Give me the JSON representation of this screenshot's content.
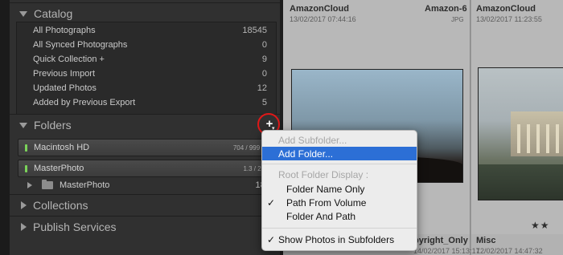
{
  "catalog": {
    "title": "Catalog",
    "items": [
      {
        "label": "All Photographs",
        "count": "18545"
      },
      {
        "label": "All Synced Photographs",
        "count": "0"
      },
      {
        "label": "Quick Collection  +",
        "count": "9"
      },
      {
        "label": "Previous Import",
        "count": "0"
      },
      {
        "label": "Updated Photos",
        "count": "12"
      },
      {
        "label": "Added by Previous Export",
        "count": "5"
      }
    ]
  },
  "folders": {
    "title": "Folders",
    "volumes": [
      {
        "name": "Macintosh HD",
        "size": "704 / 999 GB"
      },
      {
        "name": "MasterPhoto",
        "size": "1.3 / 2 TB"
      }
    ],
    "folder": {
      "name": "MasterPhoto",
      "count": "1825"
    }
  },
  "collections": {
    "title": "Collections"
  },
  "publish": {
    "title": "Publish Services"
  },
  "context_menu": {
    "add_subfolder": "Add Subfolder...",
    "add_folder": "Add Folder...",
    "root_display_label": "Root Folder Display :",
    "folder_name_only": "Folder Name Only",
    "path_from_volume": "Path From Volume",
    "folder_and_path": "Folder And Path",
    "show_photos_subfolders": "Show Photos in Subfolders",
    "checkmark": "✓"
  },
  "grid": {
    "cell1": {
      "source": "AmazonCloud",
      "date": "13/02/2017 07:44:16",
      "name": "Amazon-6",
      "ext": "JPG"
    },
    "cell2": {
      "source": "AmazonCloud",
      "date": "13/02/2017 11:23:55"
    },
    "bottom1": {
      "name": "pyright_Only",
      "date": "14/02/2017 15:13:17"
    },
    "bottom2": {
      "name": "Misc",
      "date": "12/02/2017 14:47:32"
    },
    "stars": "★★"
  }
}
